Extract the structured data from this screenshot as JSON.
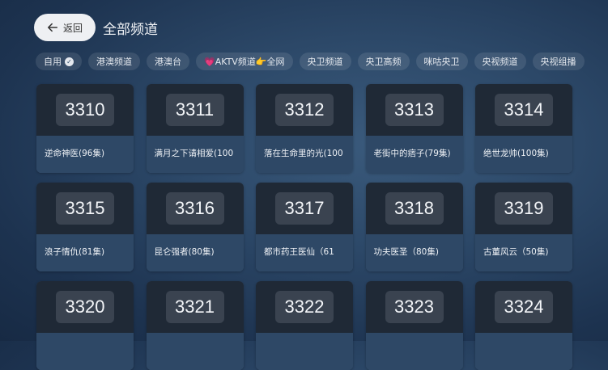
{
  "header": {
    "back_label": "返回",
    "title": "全部频道"
  },
  "chips": [
    {
      "label": "自用",
      "checked": true
    },
    {
      "label": "港澳频道"
    },
    {
      "label": "港澳台"
    },
    {
      "label": "💗AKTV频道👉全网"
    },
    {
      "label": "央卫频道"
    },
    {
      "label": "央卫高频"
    },
    {
      "label": "咪咕央卫"
    },
    {
      "label": "央视频道"
    },
    {
      "label": "央视组播"
    }
  ],
  "channels": [
    {
      "number": "3310",
      "name": "逆命神医(96集)"
    },
    {
      "number": "3311",
      "name": "满月之下请相爱(100"
    },
    {
      "number": "3312",
      "name": "落在生命里的光(100"
    },
    {
      "number": "3313",
      "name": "老街中的痞子(79集)"
    },
    {
      "number": "3314",
      "name": "绝世龙帅(100集)"
    },
    {
      "number": "3315",
      "name": "浪子情仇(81集)"
    },
    {
      "number": "3316",
      "name": "昆仑强者(80集)"
    },
    {
      "number": "3317",
      "name": "都市药王医仙（61"
    },
    {
      "number": "3318",
      "name": "功夫医圣（80集)"
    },
    {
      "number": "3319",
      "name": "古董风云（50集)"
    },
    {
      "number": "3320",
      "name": ""
    },
    {
      "number": "3321",
      "name": ""
    },
    {
      "number": "3322",
      "name": ""
    },
    {
      "number": "3323",
      "name": ""
    },
    {
      "number": "3324",
      "name": ""
    }
  ]
}
